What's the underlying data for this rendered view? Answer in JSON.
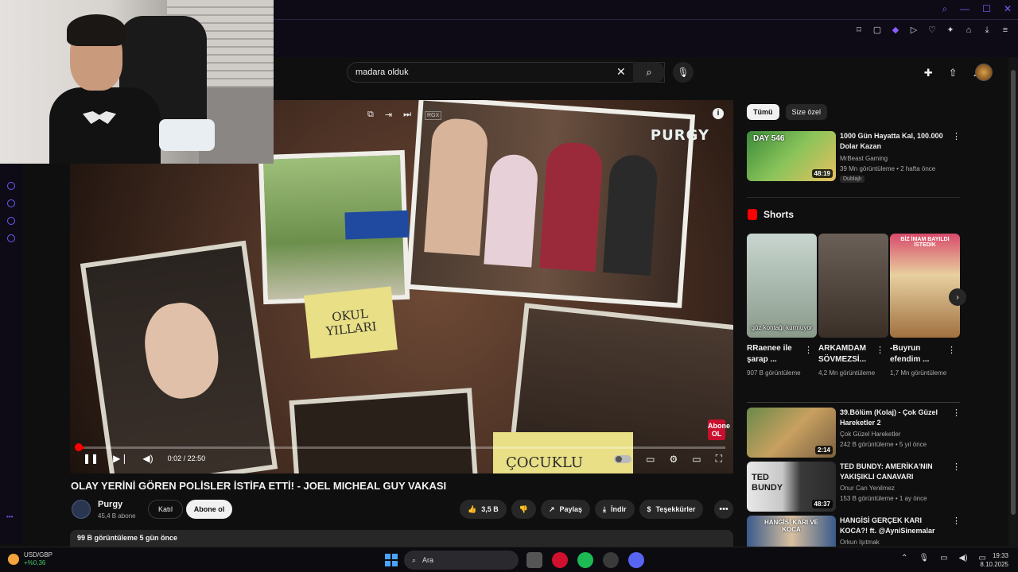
{
  "search": {
    "query": "madara olduk",
    "clear_icon": "close-icon",
    "search_icon": "search-icon",
    "mic_icon": "mic-icon"
  },
  "player": {
    "brand": "PURGY",
    "rgx_tag": "RGX",
    "note_1": "OKUL YILLARI",
    "note_2": "ÇOCUKLU",
    "sub_badge": "Abone OL",
    "time": "0:02 / 22:50",
    "progress_fraction": 0.0015
  },
  "video": {
    "title": "OLAY YERİNİ GÖREN POLİSLER İSTİFA ETTİ! - JOEL MICHEAL GUY VAKASI",
    "channel": "Purgy",
    "subscribers": "45,4 B abone",
    "join_label": "Katıl",
    "subscribe_label": "Abone ol",
    "likes": "3,5 B",
    "share_label": "Paylaş",
    "download_label": "İndir",
    "thanks_label": "Teşekkürler",
    "views_date": "99 B görüntüleme  5 gün önce"
  },
  "chips": [
    "Tümü",
    "Size özel"
  ],
  "recommended_top": {
    "title": "1000 Gün Hayatta Kal, 100.000 Dolar Kazan",
    "channel": "MrBeast Gaming",
    "meta": "39 Mn görüntüleme • 2 hafta önce",
    "badge": "Dublajlı",
    "duration": "48:19",
    "thumb_text": "DAY 546"
  },
  "shorts": {
    "header": "Shorts",
    "items": [
      {
        "title": "RRaenee ile şarap ...",
        "views": "907 B görüntüleme",
        "caption": "göz kontağı kurmuyor"
      },
      {
        "title": "ARKAMDAM SÖVMEZSİ...",
        "views": "4,2 Mn görüntüleme",
        "caption": ""
      },
      {
        "title": "-Buyrun efendim ...",
        "views": "1,7 Mn görüntüleme",
        "caption": "BİZ İMAM BAYILDI İSTEDİK"
      }
    ]
  },
  "recommended": [
    {
      "title": "39.Bölüm (Kolaj) - Çok Güzel Hareketler 2",
      "channel": "Çok Güzel Hareketler",
      "meta": "242 B görüntüleme • 5 yıl önce",
      "duration": "2:14"
    },
    {
      "title": "TED BUNDY: AMERİKA'NIN YAKIŞIKLI CANAVARI",
      "channel": "Onur Can Yenilmez",
      "meta": "153 B görüntüleme • 1 ay önce",
      "duration": "48:37",
      "thumb_text": "TED BUNDY"
    },
    {
      "title": "HANGİSİ GERÇEK KARI KOCA?! ft. @AyniSinemalar",
      "channel": "Orkun Işıtmak",
      "meta": "",
      "duration": "",
      "thumb_text": "HANGİSİ KARI VE KOCA"
    }
  ],
  "taskbar": {
    "ticker_name": "USD/GBP",
    "ticker_change": "+%0,36",
    "search_label": "Ara",
    "time": "19:33",
    "date": "8.10.2025"
  }
}
